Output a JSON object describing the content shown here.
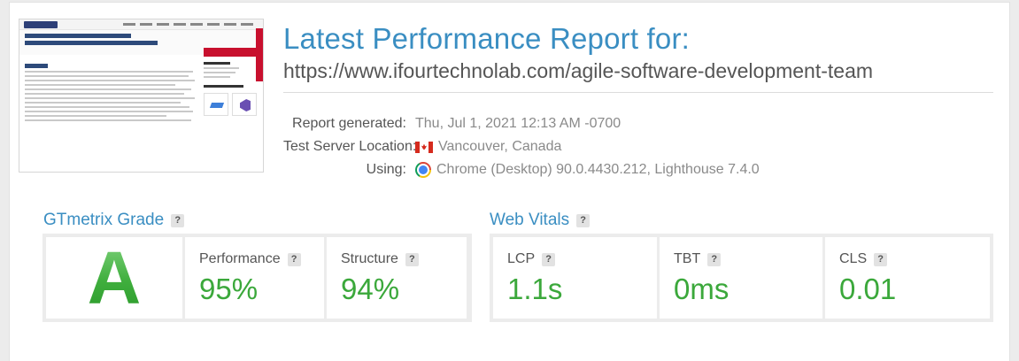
{
  "report": {
    "title": "Latest Performance Report for:",
    "url": "https://www.ifourtechnolab.com/agile-software-development-team"
  },
  "meta": {
    "generated_label": "Report generated:",
    "generated_value": "Thu, Jul 1, 2021 12:13 AM -0700",
    "location_label": "Test Server Location:",
    "location_value": "Vancouver, Canada",
    "location_icon": "canada-flag-icon",
    "using_label": "Using:",
    "using_value": "Chrome (Desktop) 90.0.4430.212, Lighthouse 7.4.0",
    "using_icon": "chrome-icon"
  },
  "grade": {
    "section_title": "GTmetrix Grade",
    "letter": "A",
    "performance_label": "Performance",
    "performance_value": "95%",
    "structure_label": "Structure",
    "structure_value": "94%"
  },
  "vitals": {
    "section_title": "Web Vitals",
    "lcp_label": "LCP",
    "lcp_value": "1.1s",
    "tbt_label": "TBT",
    "tbt_value": "0ms",
    "cls_label": "CLS",
    "cls_value": "0.01"
  },
  "help_glyph": "?",
  "colors": {
    "title_blue": "#3a8ec2",
    "good_green": "#3ba83b",
    "panel_gray": "#ececec"
  }
}
